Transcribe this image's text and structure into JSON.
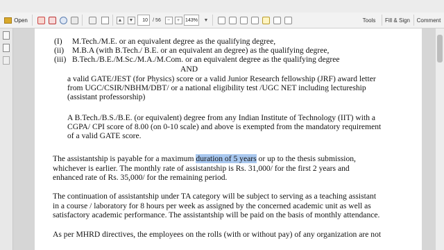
{
  "window": {
    "title": ""
  },
  "toolbar": {
    "open_label": "Open",
    "page_current": "10",
    "page_total": "/ 56",
    "zoom": "143%",
    "tools_label": "Tools",
    "fill_sign_label": "Fill & Sign",
    "comment_label": "Comment"
  },
  "document": {
    "list": [
      {
        "num": "(I)",
        "text": "M.Tech./M.E. or an equivalent degree as the qualifying degree,"
      },
      {
        "num": "(ii)",
        "text": "M.B.A (with B.Tech./ B.E. or an equivalent an degree) as the qualifying degree,"
      },
      {
        "num": "(iii)",
        "text": "B.Tech./B.E./M.Sc./M.A./M.Com. or an  equivalent degree as the  qualifying degree"
      }
    ],
    "and_text": "AND",
    "gate_lines": [
      "a valid GATE/JEST (for Physics) score or a valid Junior Research fellowship (JRF) award letter",
      "from UGC/CSIR/NBHM/DBT/ or a national eligibility test /UGC NET including lectureship",
      "(assistant professorship)"
    ],
    "iit_lines": [
      "A  B.Tech./B.S./B.E. (or equivalent) degree from any Indian Institute of Technology (IIT) with a",
      "CGPA/ CPI score of 8.00 (on 0-10 scale) and above is exempted from the mandatory requirement",
      "of a valid GATE score."
    ],
    "assist": {
      "l1_pre": "The assistantship is payable for a maximum ",
      "l1_hl": "duration of   5 years",
      "l1_post": " or up to the thesis submission,",
      "l2": "whichever is earlier. The monthly rate of assistantship is Rs. 31,000/  for the first 2 years and",
      "l3": "enhanced rate of Rs. 35,000/  for the remaining period."
    },
    "continuation_lines": [
      "The continuation of assistantship under TA category will be subject to serving as a teaching assistant",
      "in a course / laboratory for 8 hours per week as assigned by the concerned academic unit as well as",
      "satisfactory academic performance. The assistantship will be paid on the basis of monthly attendance."
    ],
    "mhrd_line": "As per MHRD directives, the employees on the rolls (with or without pay) of any organization are not"
  }
}
